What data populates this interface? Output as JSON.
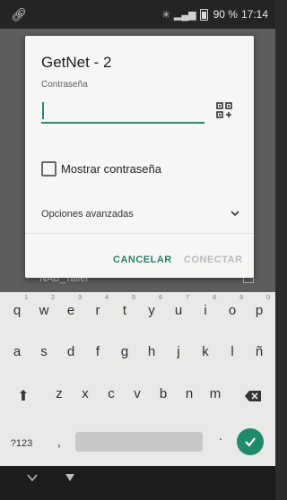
{
  "status_bar": {
    "battery": "90 %",
    "time": "17:14",
    "link_icon": "link-icon",
    "bt_icon": "bluetooth-icon",
    "signal_icon": "signal-icon"
  },
  "background": {
    "item_label": "NAB_Taller"
  },
  "dialog": {
    "title": "GetNet - 2",
    "password_label": "Contraseña",
    "password_value": "",
    "show_password_label": "Mostrar contraseña",
    "show_password_checked": false,
    "advanced_label": "Opciones avanzadas",
    "cancel_label": "CANCELAR",
    "connect_label": "CONECTAR"
  },
  "keyboard": {
    "row1": [
      {
        "key": "q",
        "hint": "1"
      },
      {
        "key": "w",
        "hint": "2"
      },
      {
        "key": "e",
        "hint": "3"
      },
      {
        "key": "r",
        "hint": "4"
      },
      {
        "key": "t",
        "hint": "5"
      },
      {
        "key": "y",
        "hint": "6"
      },
      {
        "key": "u",
        "hint": "7"
      },
      {
        "key": "i",
        "hint": "8"
      },
      {
        "key": "o",
        "hint": "9"
      },
      {
        "key": "p",
        "hint": "0"
      }
    ],
    "row2": [
      "a",
      "s",
      "d",
      "f",
      "g",
      "h",
      "j",
      "k",
      "l",
      "ñ"
    ],
    "row3": [
      "z",
      "x",
      "c",
      "v",
      "b",
      "n",
      "m"
    ],
    "symbols_label": "?123",
    "comma_label": ",",
    "period_label": ".",
    "accent_color": "#1f8a6c"
  },
  "colors": {
    "accent": "#2a7f6a",
    "disabled": "#b9bcbb"
  }
}
